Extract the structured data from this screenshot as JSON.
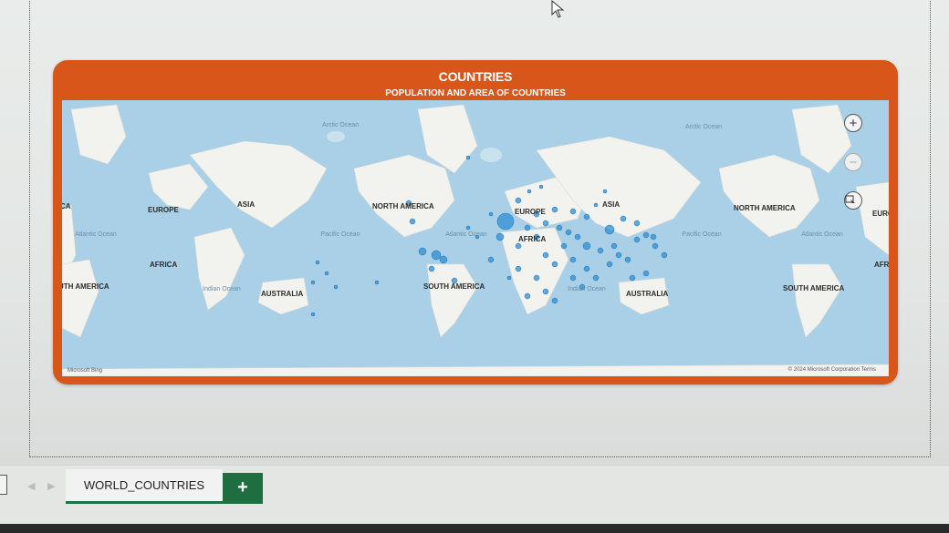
{
  "card": {
    "title": "COUNTRIES",
    "subtitle": "POPULATION AND AREA OF COUNTRIES"
  },
  "map": {
    "continent_labels": [
      {
        "text": "CA"
      },
      {
        "text": "EUROPE"
      },
      {
        "text": "ASIA"
      },
      {
        "text": "AFRICA"
      },
      {
        "text": "UTH AMERICA"
      },
      {
        "text": "AUSTRALIA"
      },
      {
        "text": "NORTH AMERICA"
      },
      {
        "text": "EUROPE"
      },
      {
        "text": "ASIA"
      },
      {
        "text": "AFRICA"
      },
      {
        "text": "SOUTH AMERICA"
      },
      {
        "text": "AUSTRALIA"
      },
      {
        "text": "NORTH AMERICA"
      },
      {
        "text": "EURO"
      },
      {
        "text": "AFR"
      },
      {
        "text": "SOUTH AMERICA"
      }
    ],
    "ocean_labels": [
      {
        "text": "Arctic Ocean"
      },
      {
        "text": "Atlantic Ocean"
      },
      {
        "text": "Pacific Ocean"
      },
      {
        "text": "Indian Ocean"
      },
      {
        "text": "Atlantic Ocean"
      },
      {
        "text": "Indian Ocean"
      },
      {
        "text": "Arctic Ocean"
      },
      {
        "text": "Pacific Ocean"
      },
      {
        "text": "Atlantic Ocean"
      }
    ],
    "controls": {
      "zoom_in": "+",
      "zoom_out": "−"
    },
    "logo_text": "Microsoft Bing",
    "copyright": "© 2024 Microsoft Corporation   Terms",
    "bubble_color": "#2f8fd6"
  },
  "sheet_tabs": {
    "nav_prev": "◀",
    "nav_next": "▶",
    "active_tab": "WORLD_COUNTRIES",
    "add_label": "+"
  },
  "colors": {
    "card_orange": "#d8561a",
    "ocean": "#a9d0e6",
    "land": "#f2f2ee",
    "excel_green": "#1f6e3f"
  }
}
